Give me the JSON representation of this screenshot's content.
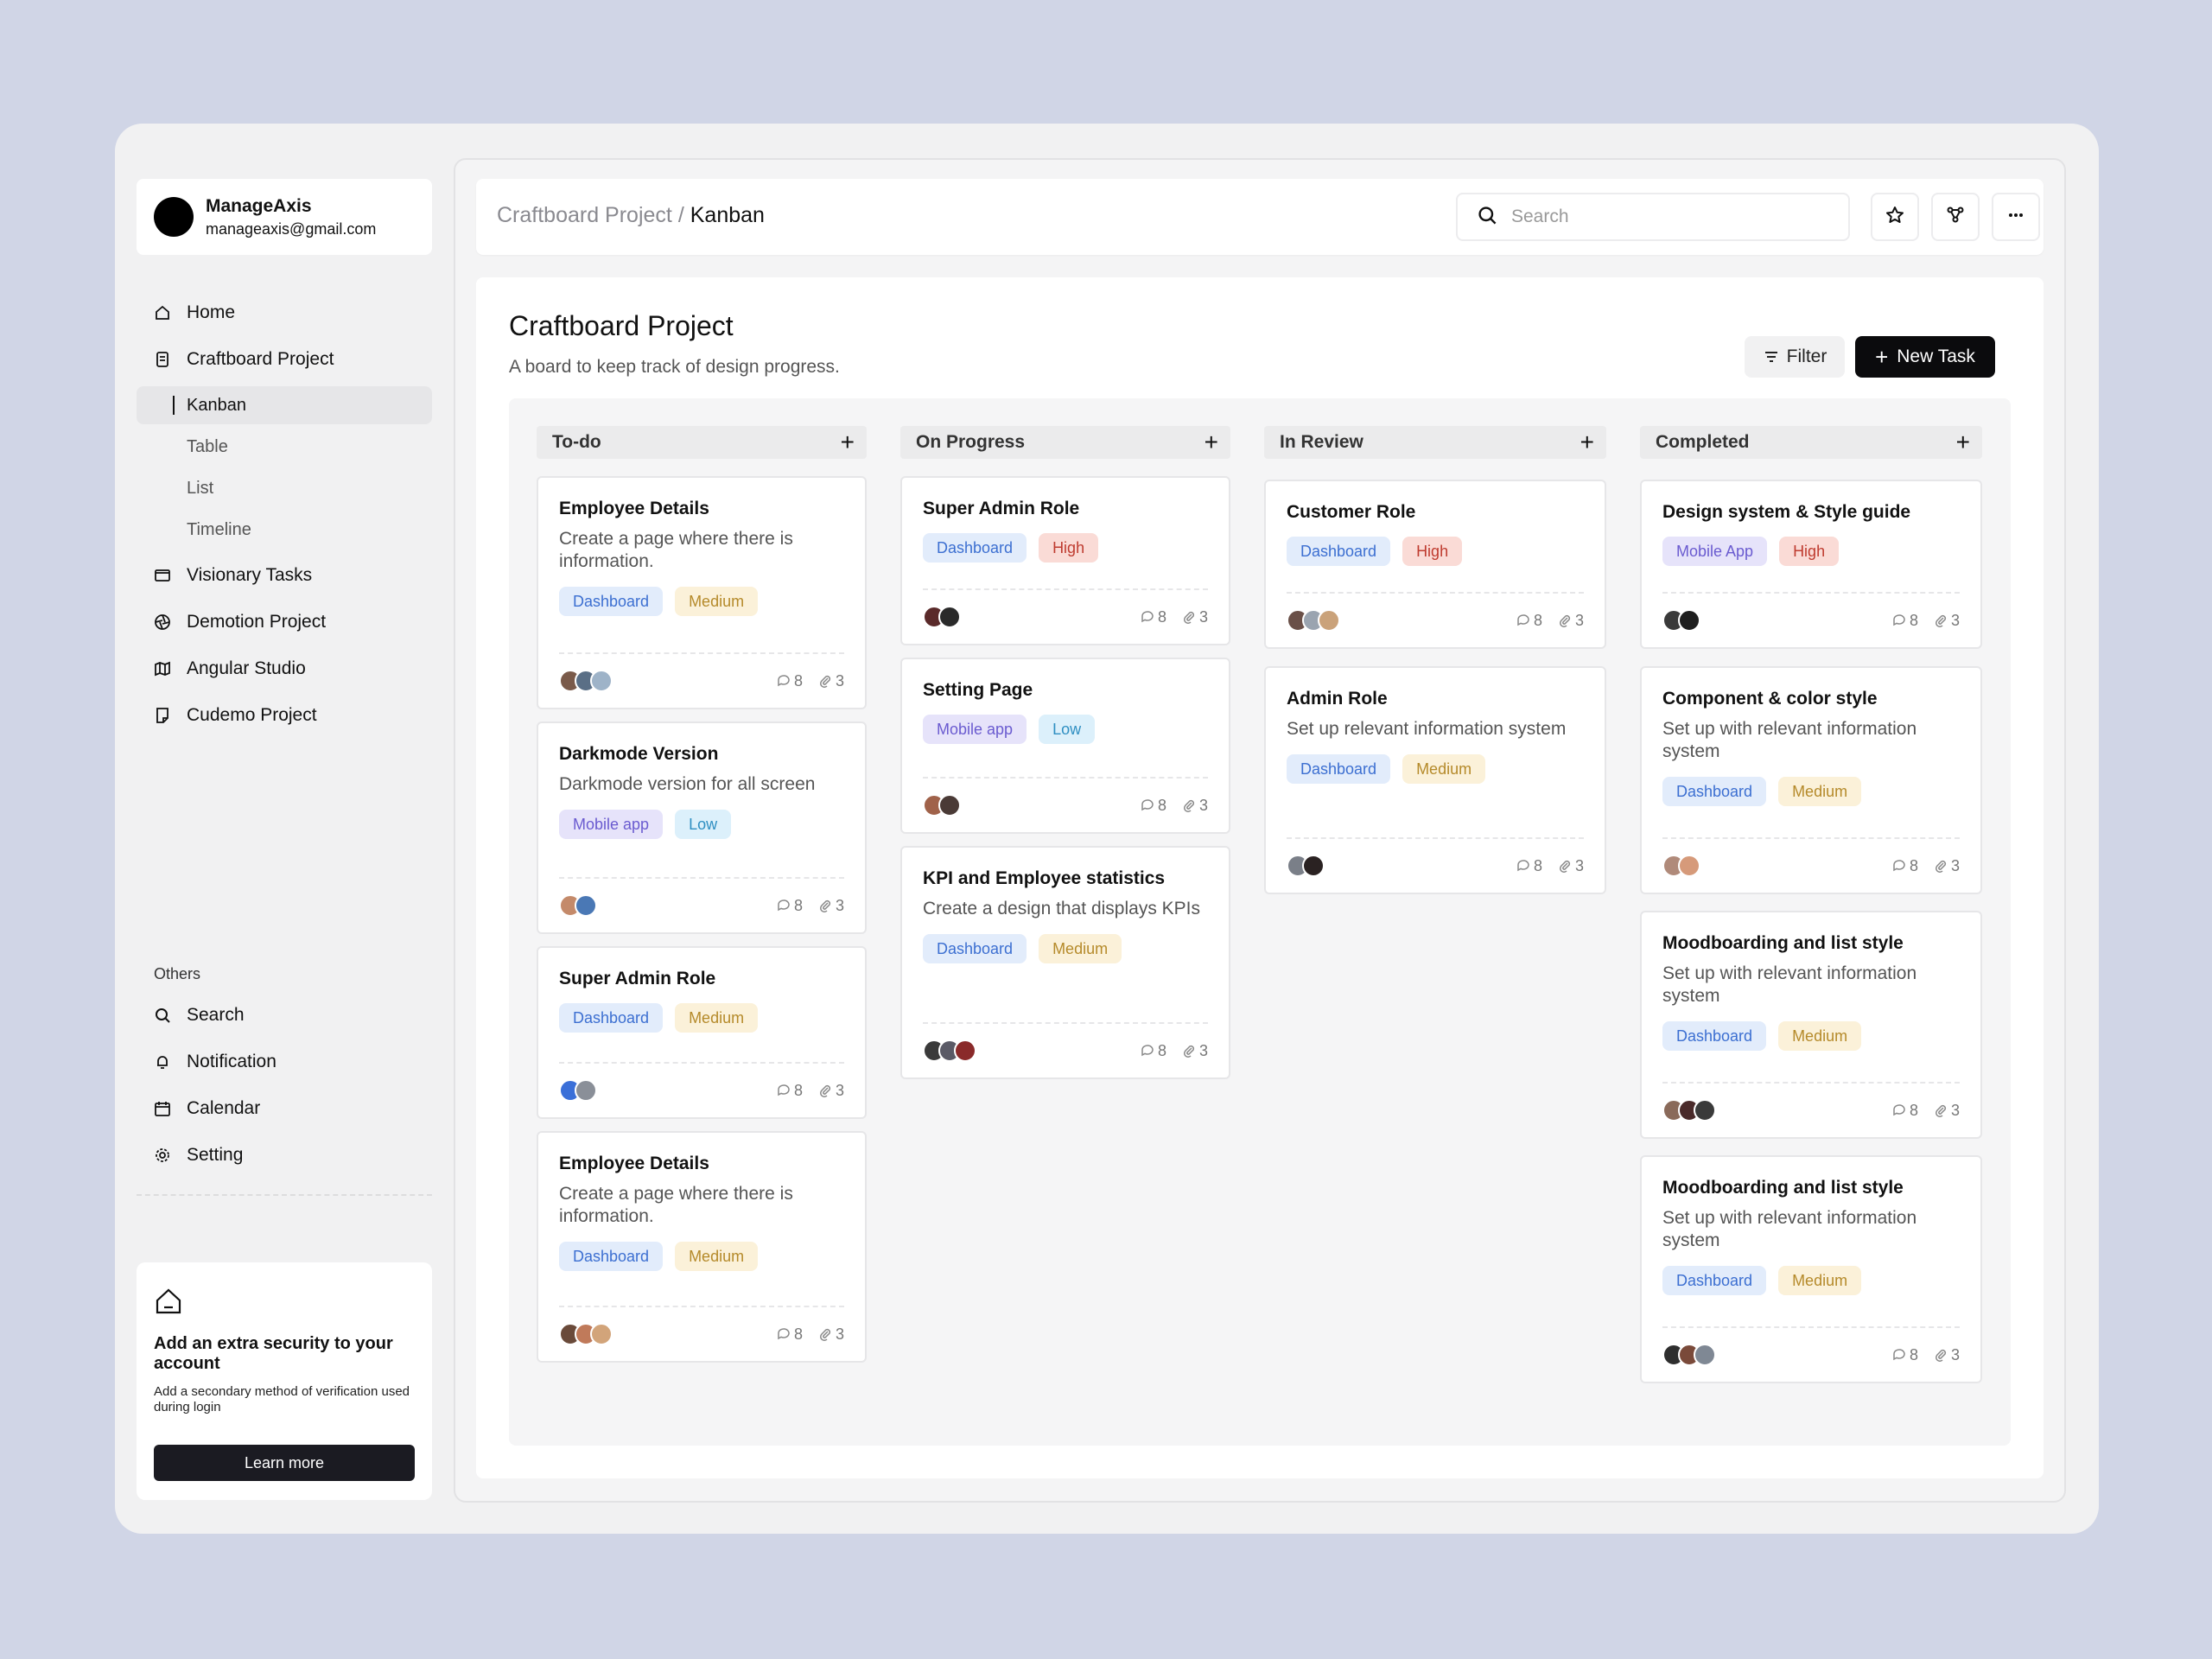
{
  "profile": {
    "name": "ManageAxis",
    "email": "manageaxis@gmail.com"
  },
  "nav": {
    "home": "Home",
    "craftboard": "Craftboard Project",
    "sub": [
      "Kanban",
      "Table",
      "List",
      "Timeline"
    ],
    "visionary": "Visionary Tasks",
    "demotion": "Demotion Project",
    "angular": "Angular Studio",
    "cudemo": "Cudemo Project"
  },
  "others": {
    "label": "Others",
    "search": "Search",
    "notification": "Notification",
    "calendar": "Calendar",
    "setting": "Setting"
  },
  "security": {
    "title": "Add an extra security to your account",
    "desc": "Add a secondary method of verification used during login",
    "button": "Learn more"
  },
  "topbar": {
    "crumb_parent": "Craftboard Project",
    "crumb_sep": "/",
    "crumb_current": "Kanban",
    "search_placeholder": "Search"
  },
  "board": {
    "title": "Craftboard Project",
    "subtitle": "A board to keep track of design progress.",
    "filter": "Filter",
    "new_task": "New Task",
    "columns": [
      {
        "name": "To-do",
        "cards": [
          {
            "title": "Employee Details",
            "desc": "Create a page where there is information.",
            "tags": [
              "Dashboard",
              "Medium"
            ],
            "comments": "8",
            "attachments": "3"
          },
          {
            "title": "Darkmode Version",
            "desc": "Darkmode version for all screen",
            "tags": [
              "Mobile app",
              "Low"
            ],
            "comments": "8",
            "attachments": "3"
          },
          {
            "title": "Super Admin Role",
            "desc": "",
            "tags": [
              "Dashboard",
              "Medium"
            ],
            "comments": "8",
            "attachments": "3"
          },
          {
            "title": "Employee Details",
            "desc": "Create a page where there is information.",
            "tags": [
              "Dashboard",
              "Medium"
            ],
            "comments": "8",
            "attachments": "3"
          }
        ]
      },
      {
        "name": "On Progress",
        "cards": [
          {
            "title": "Super Admin Role",
            "desc": "",
            "tags": [
              "Dashboard",
              "High"
            ],
            "comments": "8",
            "attachments": "3"
          },
          {
            "title": "Setting Page",
            "desc": "",
            "tags": [
              "Mobile app",
              "Low"
            ],
            "comments": "8",
            "attachments": "3"
          },
          {
            "title": "KPI and Employee statistics",
            "desc": "Create a design that displays KPIs",
            "tags": [
              "Dashboard",
              "Medium"
            ],
            "comments": "8",
            "attachments": "3"
          }
        ]
      },
      {
        "name": "In Review",
        "cards": [
          {
            "title": "Customer Role",
            "desc": "",
            "tags": [
              "Dashboard",
              "High"
            ],
            "comments": "8",
            "attachments": "3"
          },
          {
            "title": "Admin Role",
            "desc": "Set up relevant information system",
            "tags": [
              "Dashboard",
              "Medium"
            ],
            "comments": "8",
            "attachments": "3"
          }
        ]
      },
      {
        "name": "Completed",
        "cards": [
          {
            "title": "Design system & Style guide",
            "desc": "",
            "tags": [
              "Mobile App",
              "High"
            ],
            "comments": "8",
            "attachments": "3"
          },
          {
            "title": "Component & color style",
            "desc": "Set up with relevant information system",
            "tags": [
              "Dashboard",
              "Medium"
            ],
            "comments": "8",
            "attachments": "3"
          },
          {
            "title": "Moodboarding and list style",
            "desc": "Set up with relevant information system",
            "tags": [
              "Dashboard",
              "Medium"
            ],
            "comments": "8",
            "attachments": "3"
          },
          {
            "title": "Moodboarding and list style",
            "desc": "Set up with relevant information system",
            "tags": [
              "Dashboard",
              "Medium"
            ],
            "comments": "8",
            "attachments": "3"
          }
        ]
      }
    ]
  },
  "colors": {
    "background": "#d0d5e6",
    "primary_button": "#0b0b0d",
    "tag_dashboard": "#3c6fd1",
    "tag_medium": "#b58a2a",
    "tag_high": "#bf3b2f",
    "tag_low": "#2f8fc2",
    "tag_mobile": "#6a5bd0"
  }
}
